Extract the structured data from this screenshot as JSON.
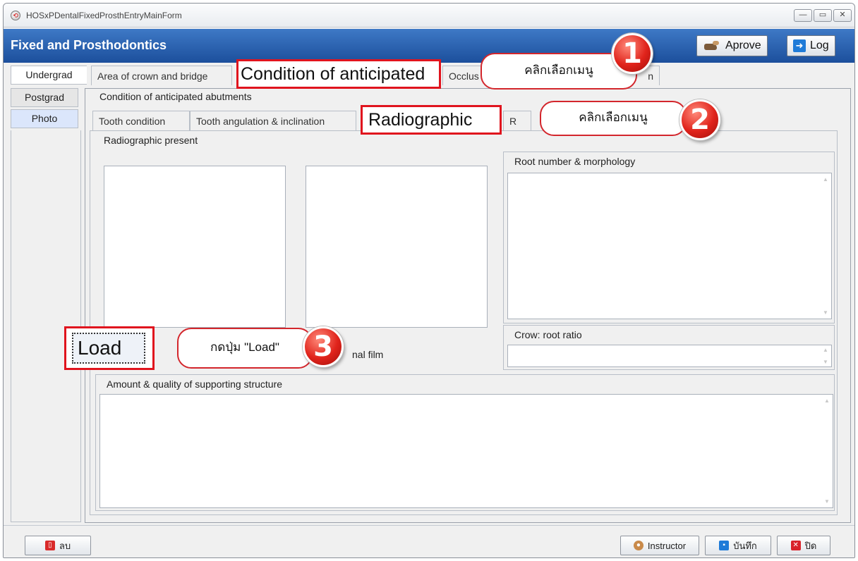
{
  "window": {
    "title": "HOSxPDentalFixedProsthEntryMainForm"
  },
  "header": {
    "title": "Fixed and Prosthodontics",
    "approve_label": "Aprove",
    "log_label": "Log"
  },
  "sidebar": {
    "items": [
      {
        "label": "Undergrad"
      },
      {
        "label": "Postgrad"
      },
      {
        "label": "Photo"
      }
    ]
  },
  "top_tabs": [
    {
      "label": "Area of crown and bridge"
    },
    {
      "label": "Condition of anticipated"
    },
    {
      "label": "Occlus"
    },
    {
      "label": "n"
    }
  ],
  "strip_label": "Condition of anticipated abutments",
  "sub_tabs": [
    {
      "label": "Tooth condition"
    },
    {
      "label": "Tooth angulation & inclination"
    },
    {
      "label": "Radiographic"
    },
    {
      "label": "R"
    }
  ],
  "radiographic": {
    "group_label": "Radiographic present",
    "load_label": "Load",
    "film_label": "nal film",
    "root_label": "Root number & morphology",
    "ratio_label": "Crow: root ratio",
    "amount_label": "Amount & quality of supporting structure"
  },
  "callouts": [
    {
      "number": "1",
      "text": "คลิกเลือกเมนู"
    },
    {
      "number": "2",
      "text": "คลิกเลือกเมนู"
    },
    {
      "number": "3",
      "text": "กดปุ่ม \"Load\""
    }
  ],
  "footer": {
    "delete_label": "ลบ",
    "instructor_label": "Instructor",
    "save_label": "บันทึก",
    "close_label": "ปิด"
  },
  "colors": {
    "header": "#1f56a6",
    "highlight": "#e0141e",
    "callout_border": "#d3262c"
  }
}
